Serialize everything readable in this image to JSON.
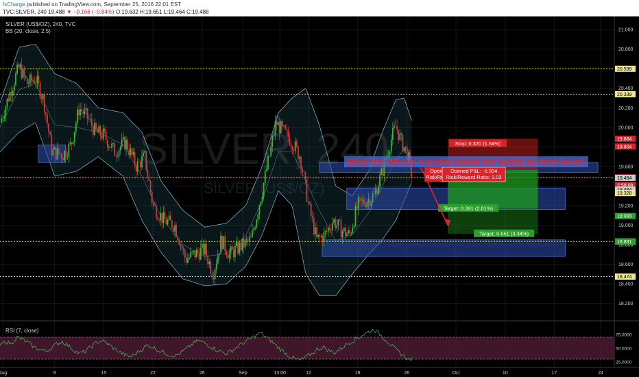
{
  "header": {
    "publisher": "fxCharge",
    "published_text": "published on TradingView.com, September 25, 2016 22:01 EST",
    "symbol_line_prefix": "TVC:SILVER, 240",
    "change": "▼ −0.166 (−0.84%)",
    "ohlc": "O:19.632 H:19.651 L:19.464 C:19.488",
    "first_close": "19.488"
  },
  "chart_data": {
    "type": "candlestick",
    "title": "SILVER (US$/OZ), 240, TVC",
    "indicator_bb": "BB (20, close, 2.5)",
    "indicator_rsi": "RSI (7, close)",
    "watermark": "SILVER, 240",
    "watermark_sub": "SILVER (US$/OZ)",
    "ylim": [
      18.05,
      21.12
    ],
    "y_ticks": [
      21.0,
      20.8,
      20.6,
      20.4,
      20.2,
      20.0,
      19.8,
      19.6,
      19.4,
      19.2,
      19.0,
      18.8,
      18.6,
      18.4,
      18.2
    ],
    "y_tick_labels": [
      "21.000",
      "20.800",
      "20.600",
      "20.400",
      "20.200",
      "20.000",
      "19.800",
      "19.600",
      "19.400",
      "19.200",
      "19.000",
      "18.800",
      "18.600",
      "18.400",
      "18.200"
    ],
    "x_ticks": [
      {
        "t": 2,
        "label": "Aug"
      },
      {
        "t": 40,
        "label": "8"
      },
      {
        "t": 76,
        "label": "15"
      },
      {
        "t": 112,
        "label": "22"
      },
      {
        "t": 148,
        "label": "26"
      },
      {
        "t": 178,
        "label": "Sep"
      },
      {
        "t": 205,
        "label": "13:00"
      },
      {
        "t": 226,
        "label": "12"
      },
      {
        "t": 262,
        "label": "19"
      },
      {
        "t": 298,
        "label": "26"
      },
      {
        "t": 334,
        "label": "Oct"
      },
      {
        "t": 370,
        "label": "10"
      },
      {
        "t": 406,
        "label": "17"
      },
      {
        "t": 440,
        "label": "24"
      }
    ],
    "t_range": [
      0,
      450
    ],
    "close_path": [
      [
        0,
        20.05
      ],
      [
        6,
        20.3
      ],
      [
        14,
        20.62
      ],
      [
        20,
        20.45
      ],
      [
        26,
        20.5
      ],
      [
        32,
        20.28
      ],
      [
        38,
        19.75
      ],
      [
        46,
        19.72
      ],
      [
        52,
        19.82
      ],
      [
        58,
        20.2
      ],
      [
        64,
        20.1
      ],
      [
        70,
        19.95
      ],
      [
        76,
        19.92
      ],
      [
        84,
        19.75
      ],
      [
        92,
        19.85
      ],
      [
        100,
        19.6
      ],
      [
        106,
        19.7
      ],
      [
        112,
        19.2
      ],
      [
        120,
        19.05
      ],
      [
        128,
        19.0
      ],
      [
        136,
        18.65
      ],
      [
        142,
        18.7
      ],
      [
        150,
        18.75
      ],
      [
        156,
        18.5
      ],
      [
        162,
        18.85
      ],
      [
        168,
        18.7
      ],
      [
        176,
        18.78
      ],
      [
        184,
        18.85
      ],
      [
        192,
        19.35
      ],
      [
        198,
        19.75
      ],
      [
        202,
        20.05
      ],
      [
        208,
        19.95
      ],
      [
        214,
        19.85
      ],
      [
        220,
        19.7
      ],
      [
        226,
        19.2
      ],
      [
        232,
        18.85
      ],
      [
        238,
        18.9
      ],
      [
        244,
        19.05
      ],
      [
        250,
        18.95
      ],
      [
        256,
        18.9
      ],
      [
        262,
        19.2
      ],
      [
        268,
        19.25
      ],
      [
        274,
        19.3
      ],
      [
        280,
        19.55
      ],
      [
        286,
        19.85
      ],
      [
        290,
        20.02
      ],
      [
        294,
        19.85
      ],
      [
        298,
        19.75
      ],
      [
        302,
        19.488
      ]
    ],
    "bb_upper": [
      [
        0,
        20.25
      ],
      [
        14,
        20.82
      ],
      [
        26,
        20.85
      ],
      [
        40,
        20.55
      ],
      [
        56,
        20.45
      ],
      [
        72,
        20.2
      ],
      [
        90,
        20.15
      ],
      [
        104,
        19.95
      ],
      [
        118,
        19.45
      ],
      [
        134,
        19.15
      ],
      [
        150,
        18.98
      ],
      [
        166,
        19.02
      ],
      [
        180,
        19.2
      ],
      [
        192,
        19.6
      ],
      [
        204,
        20.15
      ],
      [
        214,
        20.3
      ],
      [
        224,
        20.4
      ],
      [
        234,
        20.02
      ],
      [
        246,
        19.4
      ],
      [
        258,
        19.3
      ],
      [
        270,
        19.55
      ],
      [
        280,
        19.95
      ],
      [
        290,
        20.28
      ],
      [
        296,
        20.3
      ],
      [
        302,
        20.05
      ]
    ],
    "bb_lower": [
      [
        0,
        19.75
      ],
      [
        14,
        19.95
      ],
      [
        26,
        20.05
      ],
      [
        40,
        19.5
      ],
      [
        56,
        19.55
      ],
      [
        72,
        19.7
      ],
      [
        90,
        19.5
      ],
      [
        104,
        19.05
      ],
      [
        118,
        18.72
      ],
      [
        134,
        18.45
      ],
      [
        150,
        18.38
      ],
      [
        166,
        18.4
      ],
      [
        180,
        18.58
      ],
      [
        192,
        18.9
      ],
      [
        204,
        19.35
      ],
      [
        214,
        19.2
      ],
      [
        224,
        18.5
      ],
      [
        234,
        18.28
      ],
      [
        246,
        18.28
      ],
      [
        258,
        18.5
      ],
      [
        270,
        18.7
      ],
      [
        280,
        18.85
      ],
      [
        290,
        19.05
      ],
      [
        296,
        19.25
      ],
      [
        302,
        19.45
      ]
    ],
    "horizontal_levels": [
      20.599,
      20.339,
      19.484,
      18.833,
      18.474
    ],
    "price_labels": [
      {
        "v": 20.599,
        "text": "20.599",
        "color": "#f0e68c",
        "fg": "#000000"
      },
      {
        "v": 20.339,
        "text": "20.339",
        "color": "#f0e68c",
        "fg": "#000000"
      },
      {
        "v": 19.884,
        "text": "19.884",
        "color": "#d8232a",
        "fg": "#ffffff"
      },
      {
        "v": 19.804,
        "text": "19.804",
        "color": "#d8232a",
        "fg": "#ffffff"
      },
      {
        "v": 19.488,
        "text": "19.488",
        "color": "#d8232a",
        "fg": "#ffffff"
      },
      {
        "v": 19.41,
        "text": "2:59:08",
        "color": "#d8232a",
        "fg": "#ffffff"
      },
      {
        "v": 19.484,
        "text": "19.484",
        "color": "#cccccc",
        "fg": "#000000"
      },
      {
        "v": 19.363,
        "text": "19.484",
        "color": "#cccccc",
        "fg": "#000000"
      },
      {
        "v": 19.328,
        "text": "19.328",
        "color": "#f0e68c",
        "fg": "#000000"
      },
      {
        "v": 19.093,
        "text": "19.093",
        "color": "#2ca02c",
        "fg": "#ffffff"
      },
      {
        "v": 18.833,
        "text": "18.833",
        "color": "#f0e68c",
        "fg": "#000000"
      },
      {
        "v": 18.831,
        "text": "18.831",
        "color": "#2ca02c",
        "fg": "#ffffff"
      },
      {
        "v": 18.474,
        "text": "18.474",
        "color": "#f0e68c",
        "fg": "#000000"
      }
    ],
    "zones": [
      {
        "t0": 28,
        "t1": 48,
        "v0": 19.82,
        "v1": 19.64
      },
      {
        "t0": 234,
        "t1": 438,
        "v0": 19.64,
        "v1": 19.54
      },
      {
        "t0": 254,
        "t1": 414,
        "v0": 19.38,
        "v1": 19.16
      },
      {
        "t0": 236,
        "t1": 414,
        "v0": 18.85,
        "v1": 18.68
      }
    ],
    "position": {
      "entry_t": 328,
      "end_t": 394,
      "entry": 19.564,
      "stop": 19.884,
      "target1": 19.173,
      "target2": 18.913,
      "stop_label": "Stop: 0.320 (1.64%)",
      "target1_label": "Target: 0.391 (2.01%)",
      "target2_label": "Target: 0.651 (3.34%)",
      "pnl_label_back_1": "Open",
      "pnl_label_back_2": "Risk/Re",
      "pnl_label_1": "Opened P&L: -0.004",
      "pnl_label_2": "Risk/Reward Ratio: 2.03"
    },
    "annotation": "Wait for 4hour candle close for entry at that level.",
    "arrow": {
      "t0": 308,
      "v0": 19.6,
      "t1": 328,
      "v1": 19.0
    },
    "rsi": {
      "ylim": [
        15,
        95
      ],
      "ticks": [
        75,
        50,
        25
      ],
      "tick_labels": [
        "75.0000",
        "50.0000",
        "25.0000"
      ],
      "band": [
        70,
        30
      ],
      "values": [
        55,
        62,
        58,
        70,
        66,
        60,
        52,
        48,
        45,
        50,
        58,
        62,
        55,
        47,
        40,
        44,
        52,
        60,
        64,
        58,
        50,
        44,
        38,
        34,
        40,
        48,
        55,
        52,
        46,
        42,
        38,
        36,
        42,
        50,
        58,
        64,
        60,
        54,
        48,
        44,
        40,
        46,
        54,
        60,
        66,
        72,
        78,
        70,
        62,
        52,
        44,
        36,
        30,
        28,
        34,
        40,
        48,
        52,
        46,
        42,
        48,
        56,
        62,
        68,
        74,
        80,
        84,
        76,
        66,
        56,
        46,
        38,
        30
      ]
    }
  }
}
